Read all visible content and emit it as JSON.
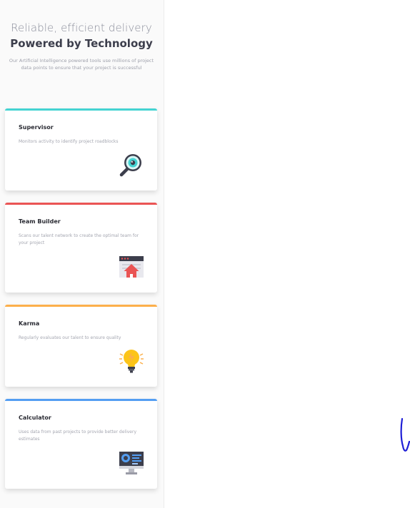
{
  "hero": {
    "tagline": "Reliable, efficient delivery",
    "headline": "Powered by Technology",
    "description": "Our Artificial Intelligence powered tools use millions of project data points to ensure that your project is successful"
  },
  "cards": [
    {
      "title": "Supervisor",
      "description": "Monitors activity to identify project roadblocks",
      "icon": "magnifier-eye-icon",
      "accent": "#44d3d2"
    },
    {
      "title": "Team Builder",
      "description": "Scans our talent network to create the optimal team for your project",
      "icon": "browser-upload-icon",
      "accent": "#ea5454"
    },
    {
      "title": "Karma",
      "description": "Regularly evaluates our talent to ensure quality",
      "icon": "lightbulb-icon",
      "accent": "#fcaf4a"
    },
    {
      "title": "Calculator",
      "description": "Uses data from past projects to provide better delivery estimates",
      "icon": "monitor-chart-icon",
      "accent": "#549ef2"
    }
  ]
}
